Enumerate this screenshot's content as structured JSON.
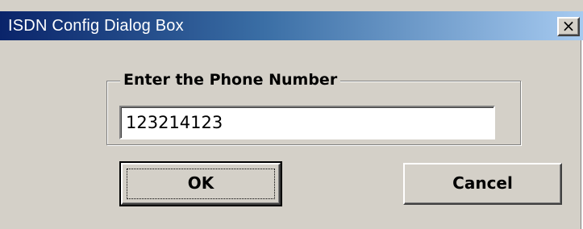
{
  "window": {
    "title": "ISDN Config Dialog Box",
    "close_glyph": "×"
  },
  "group": {
    "legend": "Enter the Phone Number"
  },
  "phone_input": {
    "value": "123214123",
    "placeholder": ""
  },
  "buttons": {
    "ok_label": "OK",
    "cancel_label": "Cancel"
  },
  "colors": {
    "dialog_face": "#d4d0c8",
    "titlebar_start": "#0a246a",
    "titlebar_end": "#a6caf0",
    "title_text": "#ffffff"
  }
}
